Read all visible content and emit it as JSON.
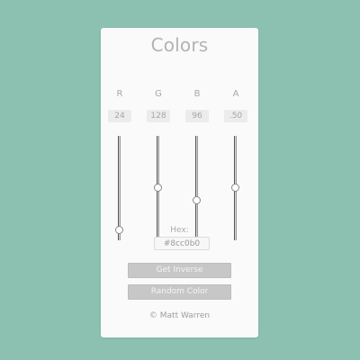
{
  "app": {
    "title": "Colors"
  },
  "channels": [
    {
      "letter": "R",
      "value": "24",
      "level": 0.094
    },
    {
      "letter": "G",
      "value": "128",
      "level": 0.502
    },
    {
      "letter": "B",
      "value": "96",
      "level": 0.376
    },
    {
      "letter": "A",
      "value": ".50",
      "level": 0.5
    }
  ],
  "hex": {
    "label": "Hex:",
    "value": "#8cc0b0"
  },
  "buttons": {
    "inverse": "Get Inverse",
    "random": "Random Color"
  },
  "footer": {
    "credit": "© Matt Warren"
  },
  "colors": {
    "background": "#8cc0b0",
    "panel": "#fafafa",
    "button": "#c7c7c7"
  }
}
